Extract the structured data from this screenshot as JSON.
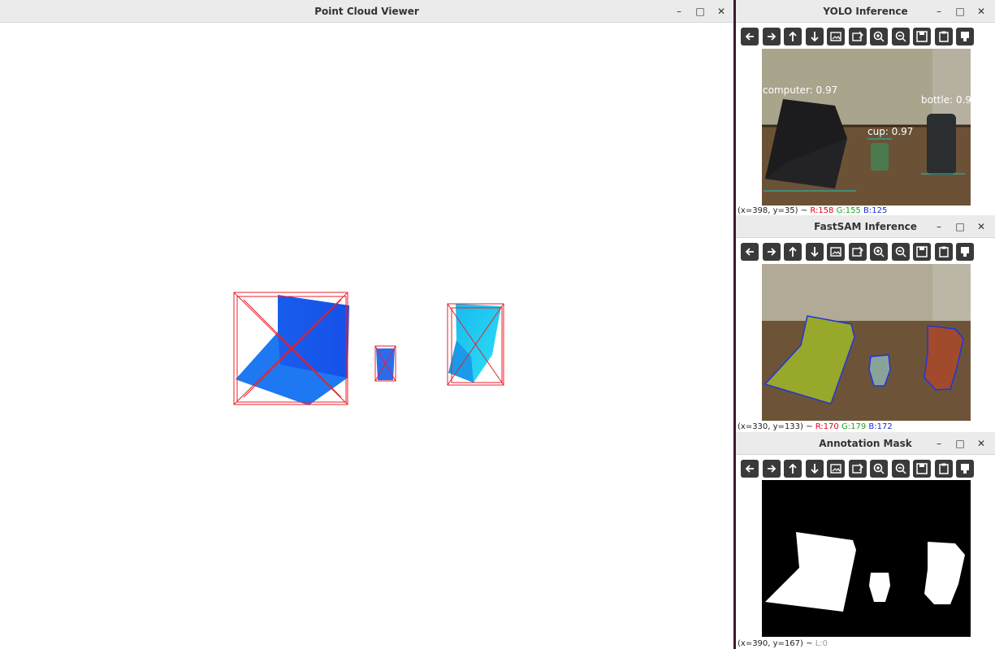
{
  "main_window": {
    "title": "Point Cloud Viewer",
    "minimize": "–",
    "maximize": "□",
    "close": "✕"
  },
  "yolo_window": {
    "title": "YOLO Inference",
    "labels": {
      "computer": "computer: 0.97",
      "bottle": "bottle: 0.9",
      "cup": "cup: 0.97"
    },
    "status": {
      "coords": "(x=398, y=35) ~",
      "r": "R:158",
      "g": "G:155",
      "b": "B:125"
    }
  },
  "fastsam_window": {
    "title": "FastSAM Inference",
    "status": {
      "coords": "(x=330, y=133) ~",
      "r": "R:170",
      "g": "G:179",
      "b": "B:172"
    }
  },
  "mask_window": {
    "title": "Annotation Mask",
    "status": {
      "coords": "(x=390, y=167) ~",
      "l": "L:0"
    }
  },
  "window_controls": {
    "minimize": "–",
    "maximize": "□",
    "close": "✕"
  },
  "toolbar_icons": [
    "arrow-left-icon",
    "arrow-right-icon",
    "arrow-up-icon",
    "arrow-down-icon",
    "image-icon",
    "image-edit-icon",
    "zoom-in-icon",
    "zoom-out-icon",
    "save-icon",
    "clipboard-icon",
    "properties-icon"
  ],
  "colors": {
    "bbox": "#e8202a",
    "cloud_dark": "#1a4fe8",
    "cloud_light": "#19c9f2",
    "sam_fill": "#98a82a",
    "sam_outline": "#2233e0"
  }
}
